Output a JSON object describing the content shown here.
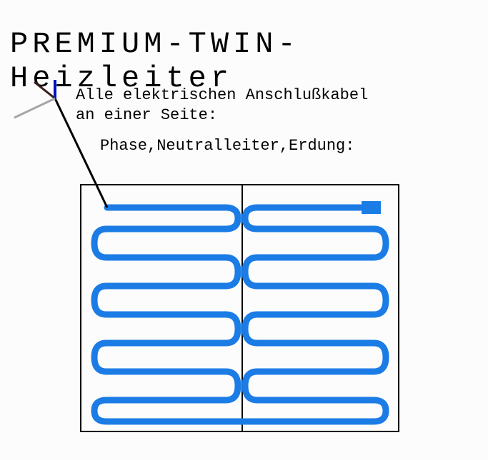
{
  "title": "PREMIUM-TWIN-Heizleiter",
  "description_line1": "Alle elektrischen Anschlußkabel\nan einer Seite:",
  "description_line2": "Phase,Neutralleiter,Erdung:",
  "colors": {
    "heating_cable": "#1b7ce5",
    "phase_wire": "#3a1d1a",
    "neutral_wire": "#0010c0",
    "earth_wire": "#a6a6a6",
    "lead_cable": "#000",
    "mat_border": "#000"
  }
}
